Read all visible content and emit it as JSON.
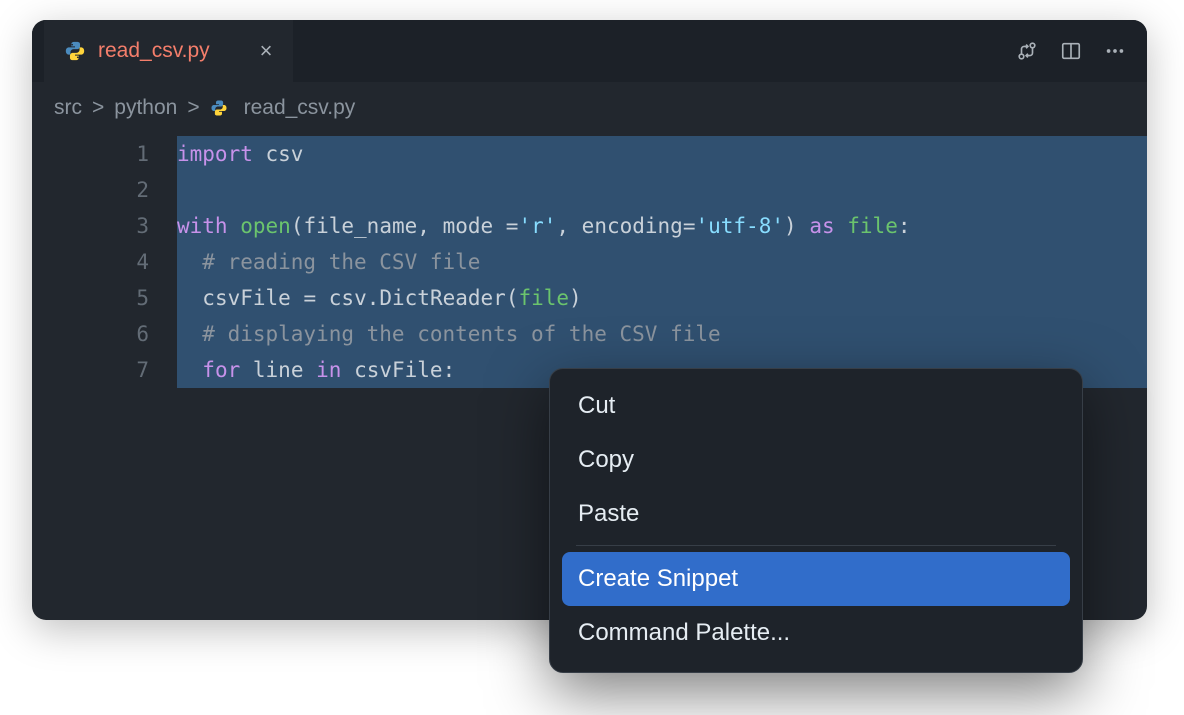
{
  "tab": {
    "filename": "read_csv.py",
    "close_glyph": "×"
  },
  "breadcrumbs": {
    "seg1": "src",
    "seg2": "python",
    "seg3": "read_csv.py",
    "sep": ">"
  },
  "gutter": [
    "1",
    "2",
    "3",
    "4",
    "5",
    "6",
    "7"
  ],
  "code": {
    "l1": {
      "kw": "import",
      "sp": " ",
      "mod": "csv"
    },
    "l2": "",
    "l3": {
      "with": "with",
      "sp1": " ",
      "open": "open",
      "lp": "(",
      "a1": "file_name",
      "c1": ", ",
      "a2": "mode ",
      "eq1": "=",
      "s1": "'r'",
      "c2": ", ",
      "a3": "encoding",
      "eq2": "=",
      "s2": "'utf-8'",
      "rp": ")",
      "sp2": " ",
      "as": "as",
      "sp3": " ",
      "file": "file",
      "colon": ":"
    },
    "l4": "  # reading the CSV file",
    "l5": {
      "indent": "  ",
      "lhs": "csvFile",
      "sp1": " ",
      "eq": "=",
      "sp2": " ",
      "mod": "csv",
      "dot": ".",
      "cls": "DictReader",
      "lp": "(",
      "arg": "file",
      "rp": ")"
    },
    "l6": "  # displaying the contents of the CSV file",
    "l7": {
      "indent": "  ",
      "for": "for",
      "sp1": " ",
      "var": "line",
      "sp2": " ",
      "in": "in",
      "sp3": " ",
      "iter": "csvFile",
      "colon": ":"
    }
  },
  "menu": {
    "cut": "Cut",
    "copy": "Copy",
    "paste": "Paste",
    "create_snippet": "Create Snippet",
    "command_palette": "Command Palette..."
  }
}
